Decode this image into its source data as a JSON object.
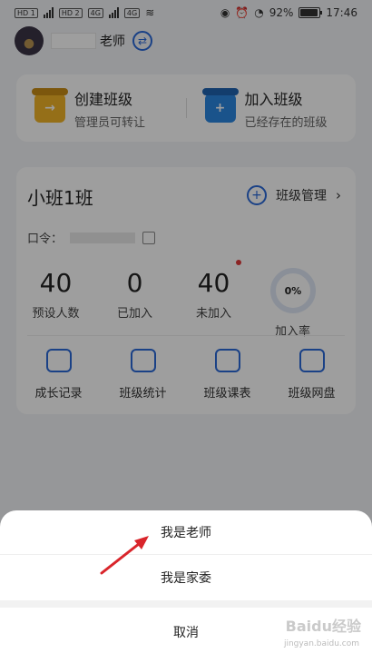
{
  "status_bar": {
    "left_tags": [
      "HD 1",
      "HD 2",
      "4G",
      "4G"
    ],
    "battery_pct": "92%",
    "battery_fill": 0.92,
    "time": "17:46"
  },
  "header": {
    "role": "老师",
    "icons": {
      "switch": "switch-icon"
    }
  },
  "actions": [
    {
      "title": "创建班级",
      "subtitle": "管理员可转让",
      "icon": "box-arrow-icon",
      "color": "#f1b327"
    },
    {
      "title": "加入班级",
      "subtitle": "已经存在的班级",
      "icon": "box-plus-icon",
      "color": "#2b86e0"
    }
  ],
  "class_card": {
    "name": "小班1班",
    "manage_label": "班级管理",
    "password_label": "口令：",
    "stats": [
      {
        "value": "40",
        "label": "预设人数"
      },
      {
        "value": "0",
        "label": "已加入"
      },
      {
        "value": "40",
        "label": "未加入"
      }
    ],
    "rate": {
      "value": "0%",
      "label": "加入率",
      "fraction": 0
    },
    "features": [
      {
        "label": "成长记录",
        "icon": "chat-icon"
      },
      {
        "label": "班级统计",
        "icon": "chart-icon"
      },
      {
        "label": "班级课表",
        "icon": "list-icon"
      },
      {
        "label": "班级网盘",
        "icon": "folder-icon"
      }
    ]
  },
  "sheet": {
    "options": [
      "我是老师",
      "我是家委"
    ],
    "cancel_label": "取消"
  },
  "watermark": {
    "main": "Baidu经验",
    "sub": "jingyan.baidu.com"
  },
  "colors": {
    "accent": "#2a69d8",
    "alert": "#e03b3b"
  }
}
